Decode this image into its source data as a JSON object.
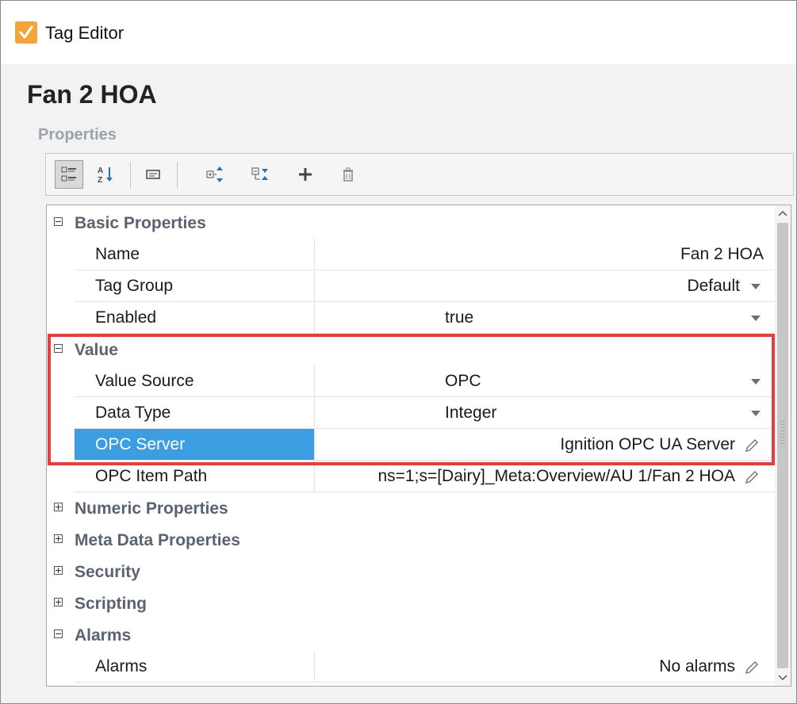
{
  "window": {
    "title": "Tag Editor"
  },
  "tag_name": "Fan 2 HOA",
  "properties_label": "Properties",
  "toolbar": {
    "buttons": [
      {
        "name": "categorized-view-icon",
        "active": true
      },
      {
        "name": "sort-alphabetical-icon",
        "active": false
      },
      {
        "name": "description-icon",
        "active": false
      },
      {
        "name": "expand-all-icon",
        "active": false
      },
      {
        "name": "collapse-all-icon",
        "active": false
      },
      {
        "name": "add-icon",
        "active": false
      },
      {
        "name": "delete-icon",
        "active": false
      }
    ]
  },
  "grid": {
    "basic": {
      "label": "Basic Properties",
      "name": {
        "label": "Name",
        "value": "Fan 2 HOA"
      },
      "tag_group": {
        "label": "Tag Group",
        "value": "Default"
      },
      "enabled": {
        "label": "Enabled",
        "value": "true"
      }
    },
    "value": {
      "label": "Value",
      "value_source": {
        "label": "Value Source",
        "value": "OPC"
      },
      "data_type": {
        "label": "Data Type",
        "value": "Integer"
      },
      "opc_server": {
        "label": "OPC Server",
        "value": "Ignition OPC UA Server"
      },
      "opc_item_path": {
        "label": "OPC Item Path",
        "value": "ns=1;s=[Dairy]_Meta:Overview/AU 1/Fan 2 HOA"
      }
    },
    "numeric": {
      "label": "Numeric Properties"
    },
    "meta": {
      "label": "Meta Data Properties"
    },
    "security": {
      "label": "Security"
    },
    "scripting": {
      "label": "Scripting"
    },
    "alarms": {
      "label": "Alarms",
      "alarms": {
        "label": "Alarms",
        "value": "No alarms"
      }
    }
  },
  "colors": {
    "highlight_border": "#e0403f",
    "selected_row": "#3c9ee0",
    "app_icon": "#f3a43a"
  }
}
